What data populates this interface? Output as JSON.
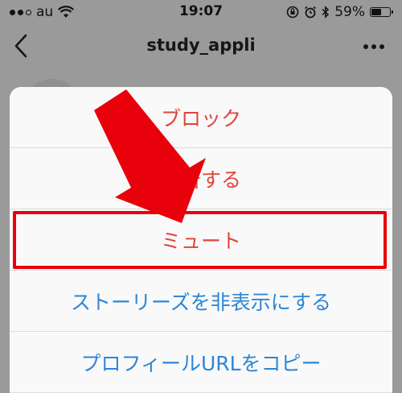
{
  "status_bar": {
    "carrier": "au",
    "time": "19:07",
    "battery_percent": "59%",
    "battery_level": 0.59
  },
  "nav": {
    "title": "study_appli"
  },
  "sheet": {
    "items": [
      {
        "label": "ブロック",
        "color": "#e0443a"
      },
      {
        "label": "報告する",
        "color": "#e0443a"
      },
      {
        "label": "ミュート",
        "color": "#e0443a"
      },
      {
        "label": "ストーリーズを非表示にする",
        "color": "#2d86d9"
      },
      {
        "label": "プロフィールURLをコピー",
        "color": "#2d86d9"
      }
    ]
  },
  "annotation": {
    "arrow_color": "#e8000b",
    "highlight_color": "#e8000b",
    "highlighted_item": "ミュート"
  }
}
